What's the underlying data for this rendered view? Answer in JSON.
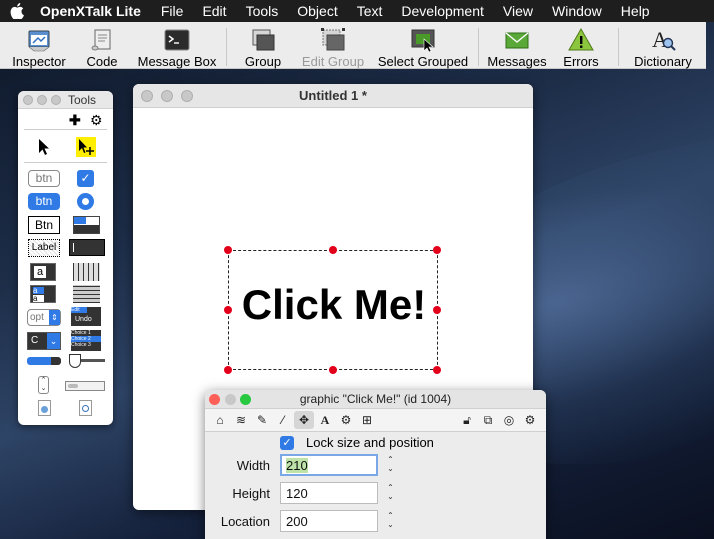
{
  "menubar": {
    "app_name": "OpenXTalk Lite",
    "items": [
      "File",
      "Edit",
      "Tools",
      "Object",
      "Text",
      "Development",
      "View",
      "Window",
      "Help"
    ]
  },
  "toolbar": {
    "items": [
      {
        "label": "Inspector",
        "icon": "inspector-icon",
        "enabled": true
      },
      {
        "label": "Code",
        "icon": "code-scroll-icon",
        "enabled": true
      },
      {
        "label": "Message Box",
        "icon": "terminal-icon",
        "enabled": true
      },
      {
        "label": "Group",
        "icon": "group-icon",
        "enabled": true
      },
      {
        "label": "Edit Group",
        "icon": "edit-group-icon",
        "enabled": false
      },
      {
        "label": "Select Grouped",
        "icon": "select-grouped-icon",
        "enabled": true
      },
      {
        "label": "Messages",
        "icon": "envelope-icon",
        "enabled": true
      },
      {
        "label": "Errors",
        "icon": "warning-icon",
        "enabled": true
      },
      {
        "label": "Dictionary",
        "icon": "dictionary-icon",
        "enabled": true
      }
    ]
  },
  "tools_palette": {
    "title": "Tools",
    "add_symbol": "✚",
    "settings_symbol": "⚙",
    "tiles": {
      "btn1": "btn",
      "btn2": "btn",
      "btn3": "Btn",
      "label": "Label",
      "field_a": "a",
      "list_a": "a",
      "list_a2": "a",
      "opt": "opt",
      "combo_c": "C",
      "edit_menu_edit": "Edit",
      "edit_menu_undo": "Undo",
      "choice1": "Choice 1",
      "choice2": "Choice 2",
      "choice3": "Choice 3"
    }
  },
  "stack_window": {
    "title": "Untitled 1 *",
    "graphic_text": "Click Me!"
  },
  "inspector": {
    "title": "graphic \"Click Me!\" (id 1004)",
    "lock_label": "Lock size and position",
    "lock_checked": true,
    "fields": [
      {
        "label": "Width",
        "value": "210"
      },
      {
        "label": "Height",
        "value": "120"
      },
      {
        "label": "Location",
        "value": "200"
      }
    ]
  },
  "colors": {
    "accent_blue": "#2f7ae5",
    "handle_red": "#e3001b",
    "selection_yellow": "#ffee00"
  }
}
